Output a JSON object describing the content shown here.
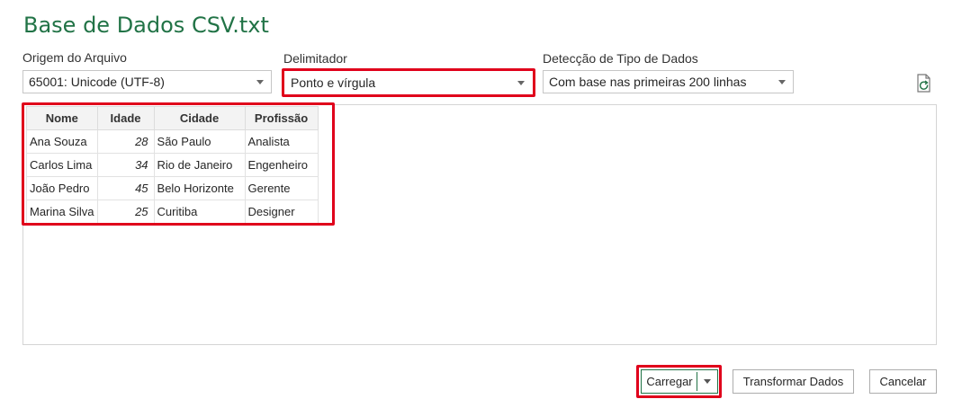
{
  "window": {
    "title": "Base de Dados CSV.txt"
  },
  "origin": {
    "label": "Origem do Arquivo",
    "value": "65001: Unicode (UTF-8)"
  },
  "delimiter": {
    "label": "Delimitador",
    "value": "Ponto e vírgula"
  },
  "type_detection": {
    "label": "Detecção de Tipo de Dados",
    "value": "Com base nas primeiras 200 linhas"
  },
  "refresh_icon": "refresh-file-icon",
  "table": {
    "columns": [
      "Nome",
      "Idade",
      "Cidade",
      "Profissão"
    ],
    "rows": [
      [
        "Ana Souza",
        "28",
        "São Paulo",
        "Analista"
      ],
      [
        "Carlos Lima",
        "34",
        "Rio de Janeiro",
        "Engenheiro"
      ],
      [
        "João Pedro",
        "45",
        "Belo Horizonte",
        "Gerente"
      ],
      [
        "Marina Silva",
        "25",
        "Curitiba",
        "Designer"
      ]
    ]
  },
  "buttons": {
    "load": "Carregar",
    "transform": "Transformar Dados",
    "cancel": "Cancelar"
  },
  "colors": {
    "title": "#217346",
    "highlight": "#e0001b"
  }
}
